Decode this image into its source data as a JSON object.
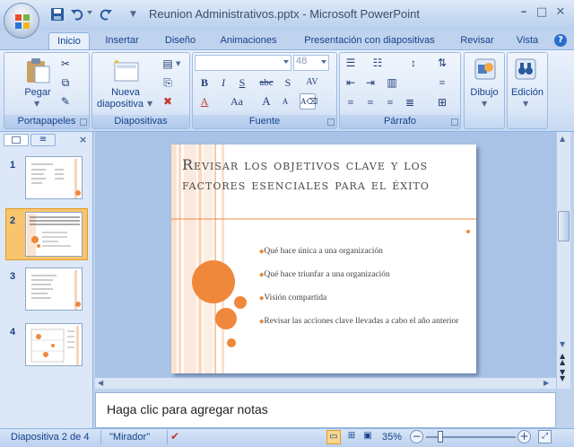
{
  "window": {
    "title": "Reunion Administrativos.pptx - Microsoft PowerPoint",
    "controls": [
      "minimize",
      "maximize",
      "close"
    ]
  },
  "quick_access": [
    "save-icon",
    "undo-icon",
    "redo-icon",
    "customize-icon"
  ],
  "tabs": [
    {
      "label": "Inicio",
      "active": true
    },
    {
      "label": "Insertar",
      "active": false
    },
    {
      "label": "Diseño",
      "active": false
    },
    {
      "label": "Animaciones",
      "active": false
    },
    {
      "label": "Presentación con diapositivas",
      "active": false
    },
    {
      "label": "Revisar",
      "active": false
    },
    {
      "label": "Vista",
      "active": false
    }
  ],
  "ribbon": {
    "portapapeles": {
      "label": "Portapapeles",
      "pegar": "Pegar"
    },
    "diapositivas": {
      "label": "Diapositivas",
      "nueva_line1": "Nueva",
      "nueva_line2": "diapositiva"
    },
    "fuente": {
      "label": "Fuente",
      "font_name": "",
      "font_size": "48",
      "bold": "B",
      "italic": "I",
      "underline": "S",
      "strike": "abc",
      "shadow": "S",
      "spacing": "AV",
      "case": "Aa",
      "grow": "A",
      "shrink": "A",
      "color": "A"
    },
    "parrafo": {
      "label": "Párrafo"
    },
    "dibujo": {
      "label": "Dibujo"
    },
    "edicion": {
      "label": "Edición"
    }
  },
  "slides_panel": {
    "thumbs": [
      {
        "number": "1",
        "selected": false
      },
      {
        "number": "2",
        "selected": true
      },
      {
        "number": "3",
        "selected": false
      },
      {
        "number": "4",
        "selected": false
      }
    ]
  },
  "slide": {
    "title": "Revisar los objetivos clave y los factores esenciales para el éxito",
    "bullets": [
      "Qué hace única a una organización",
      "Qué hace triunfar a una organización",
      "Visión compartida",
      "Revisar las acciones clave llevadas a cabo el año anterior"
    ],
    "accent_color": "#f0883c"
  },
  "notes": {
    "placeholder": "Haga clic para agregar notas"
  },
  "status": {
    "slide_info": "Diapositiva 2 de 4",
    "theme": "\"Mirador\"",
    "zoom": "35%"
  }
}
